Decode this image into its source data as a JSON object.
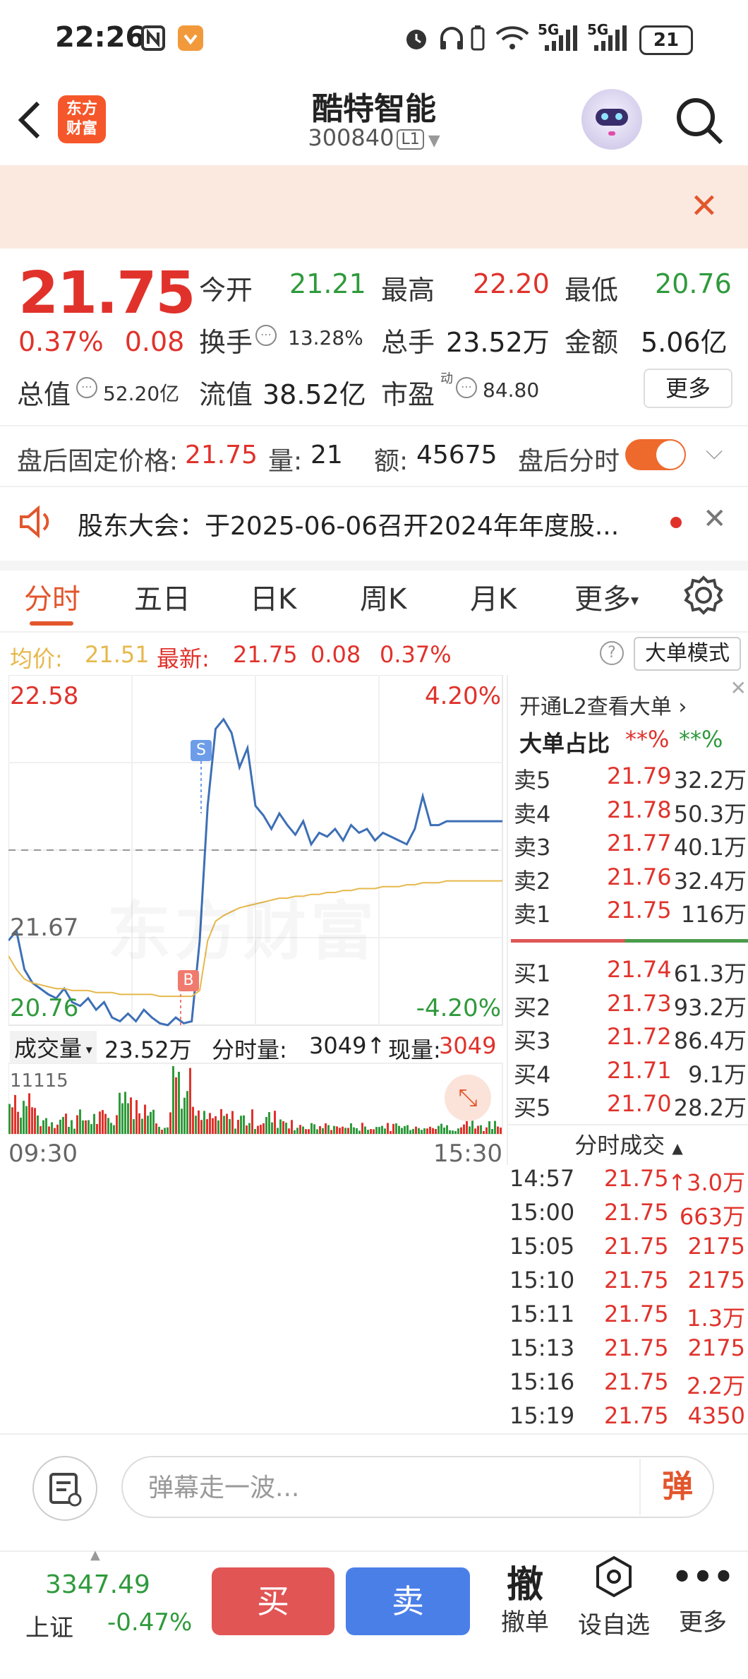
{
  "status_bar": {
    "time": "22:26",
    "battery": "21",
    "net1": "5G",
    "net2": "5G"
  },
  "header": {
    "name": "酷特智能",
    "code": "300840",
    "level_tag": "L1",
    "logo_text_1": "东方",
    "logo_text_2": "财富"
  },
  "quote": {
    "price": "21.75",
    "change_pct": "0.37%",
    "change": "0.08",
    "open_label": "今开",
    "open": "21.21",
    "high_label": "最高",
    "high": "22.20",
    "low_label": "最低",
    "low": "20.76",
    "turnover_label": "换手",
    "turnover": "13.28%",
    "volume_label": "总手",
    "volume": "23.52万",
    "amount_label": "金额",
    "amount": "5.06亿",
    "mktcap_label": "总值",
    "mktcap": "52.20亿",
    "float_label": "流值",
    "float": "38.52亿",
    "pe_label": "市盈",
    "pe_super": "动",
    "pe": "84.80",
    "more": "更多"
  },
  "after_hours": {
    "price_label": "盘后固定价格:",
    "price": "21.75",
    "vol_label": "量:",
    "vol": "21",
    "amt_label": "额:",
    "amt": "45675",
    "timeshare_label": "盘后分时"
  },
  "notice": {
    "text": "股东大会：于2025-06-06召开2024年年度股..."
  },
  "tabs": [
    "分时",
    "五日",
    "日K",
    "周K",
    "月K",
    "更多"
  ],
  "avg_bar": {
    "avg_label": "均价:",
    "avg": "21.51",
    "latest_label": "最新:",
    "latest": "21.75",
    "chg": "0.08",
    "pct": "0.37%",
    "mode": "大单模式"
  },
  "chart_data": {
    "type": "line",
    "y_max": "22.58",
    "y_min": "20.76",
    "y_ref": "21.67",
    "pct_max": "4.20%",
    "pct_min": "-4.20%",
    "x_start": "09:30",
    "x_end": "15:30",
    "marker_buy": "B",
    "marker_sell": "S",
    "watermark": "东方财富",
    "volume_label": "成交量",
    "volume_total": "23.52万",
    "minute_vol_label": "分时量:",
    "minute_vol": "3049",
    "now_vol_label": "现量:",
    "now_vol": "3049",
    "volume_max": "11115",
    "series": [
      {
        "color": "#3d6fb6",
        "values": [
          21.2,
          21.25,
          21.05,
          20.98,
          20.95,
          20.92,
          20.9,
          20.95,
          20.88,
          20.86,
          20.9,
          20.84,
          20.88,
          20.8,
          20.78,
          20.82,
          20.78,
          20.84,
          20.8,
          20.77,
          20.76,
          20.8,
          20.77,
          20.78,
          21.2,
          21.9,
          22.3,
          22.35,
          22.28,
          22.1,
          22.2,
          21.9,
          21.85,
          21.78,
          21.86,
          21.8,
          21.75,
          21.82,
          21.7,
          21.76,
          21.74,
          21.78,
          21.72,
          21.8,
          21.76,
          21.78,
          21.72,
          21.76,
          21.74,
          21.72,
          21.7,
          21.78,
          21.95,
          21.8,
          21.8,
          21.82,
          21.82,
          21.82,
          21.82,
          21.82,
          21.82,
          21.82,
          21.82
        ]
      },
      {
        "color": "#e6b84c",
        "values": [
          21.12,
          21.05,
          21.0,
          20.98,
          20.97,
          20.96,
          20.95,
          20.95,
          20.94,
          20.94,
          20.94,
          20.93,
          20.93,
          20.93,
          20.92,
          20.92,
          20.92,
          20.92,
          20.92,
          20.91,
          20.91,
          20.91,
          20.91,
          20.91,
          20.94,
          21.2,
          21.3,
          21.33,
          21.35,
          21.37,
          21.38,
          21.39,
          21.4,
          21.41,
          21.42,
          21.42,
          21.43,
          21.43,
          21.44,
          21.44,
          21.45,
          21.45,
          21.46,
          21.46,
          21.47,
          21.47,
          21.47,
          21.48,
          21.48,
          21.48,
          21.49,
          21.49,
          21.5,
          21.5,
          21.5,
          21.51,
          21.51,
          21.51,
          21.51,
          21.51,
          21.51,
          21.51,
          21.51
        ]
      }
    ]
  },
  "book": {
    "promo": "开通L2查看大单",
    "ratio_label": "大单占比",
    "ratio_red": "**%",
    "ratio_green": "**%",
    "asks": [
      {
        "label": "卖5",
        "price": "21.79",
        "vol": "32.2万"
      },
      {
        "label": "卖4",
        "price": "21.78",
        "vol": "50.3万"
      },
      {
        "label": "卖3",
        "price": "21.77",
        "vol": "40.1万"
      },
      {
        "label": "卖2",
        "price": "21.76",
        "vol": "32.4万"
      },
      {
        "label": "卖1",
        "price": "21.75",
        "vol": "116万"
      }
    ],
    "bids": [
      {
        "label": "买1",
        "price": "21.74",
        "vol": "61.3万"
      },
      {
        "label": "买2",
        "price": "21.73",
        "vol": "93.2万"
      },
      {
        "label": "买3",
        "price": "21.72",
        "vol": "86.4万"
      },
      {
        "label": "买4",
        "price": "21.71",
        "vol": "9.1万"
      },
      {
        "label": "买5",
        "price": "21.70",
        "vol": "28.2万"
      }
    ]
  },
  "trades": {
    "title": "分时成交",
    "rows": [
      {
        "time": "14:57",
        "price": "21.75",
        "vol": "↑3.0万"
      },
      {
        "time": "15:00",
        "price": "21.75",
        "vol": "663万"
      },
      {
        "time": "15:05",
        "price": "21.75",
        "vol": "2175"
      },
      {
        "time": "15:10",
        "price": "21.75",
        "vol": "2175"
      },
      {
        "time": "15:11",
        "price": "21.75",
        "vol": "1.3万"
      },
      {
        "time": "15:13",
        "price": "21.75",
        "vol": "2175"
      },
      {
        "time": "15:16",
        "price": "21.75",
        "vol": "2.2万"
      },
      {
        "time": "15:19",
        "price": "21.75",
        "vol": "4350"
      }
    ]
  },
  "comment": {
    "placeholder": "弹幕走一波...",
    "send": "弹"
  },
  "bottom": {
    "index_value": "3347.49",
    "index_name": "上证",
    "index_chg": "-0.47%",
    "buy": "买",
    "sell": "卖",
    "cancel_icon": "撤",
    "cancel": "撤单",
    "watch": "设自选",
    "more": "更多"
  },
  "colors": {
    "accent": "#e2562c",
    "up": "#e0322b",
    "down": "#2f9a3c",
    "price_line": "#3d6fb6",
    "avg_line": "#e6b84c"
  }
}
